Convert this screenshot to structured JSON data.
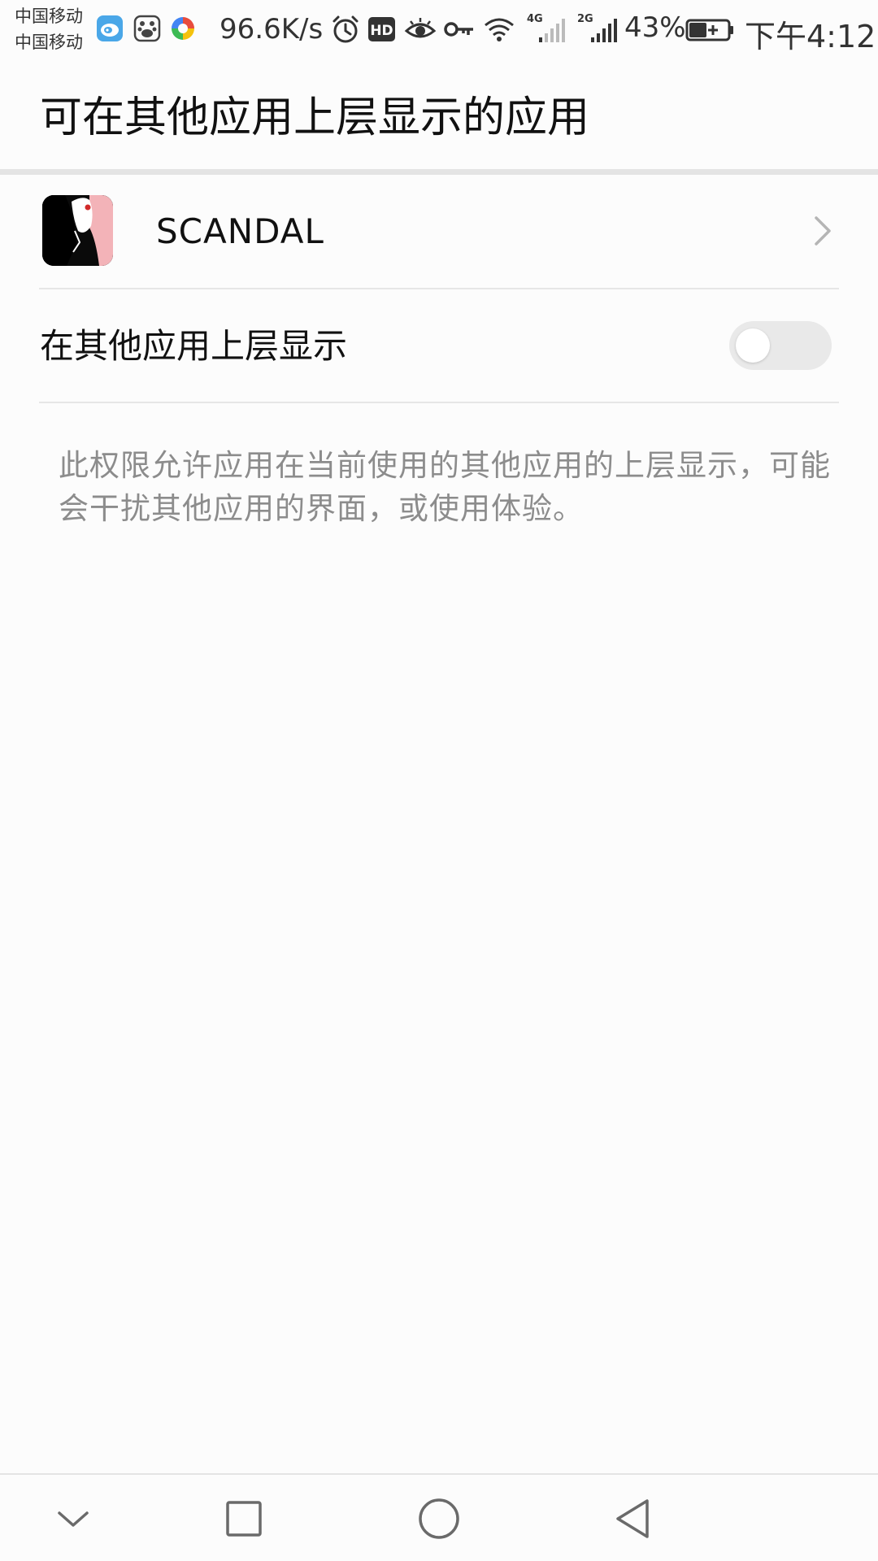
{
  "status_bar": {
    "carrier_1": "中国移动",
    "carrier_2": "中国移动",
    "network_speed": "96.6K/s",
    "signal_1_type": "4G",
    "signal_2_type": "2G",
    "battery_percent": "43%",
    "time": "下午4:12",
    "icons": [
      "weibo-icon",
      "baidu-icon",
      "color-app-icon",
      "alarm-icon",
      "hd-icon",
      "eye-icon",
      "key-icon",
      "wifi-icon",
      "signal-icon",
      "battery-icon"
    ]
  },
  "header": {
    "title": "可在其他应用上层显示的应用"
  },
  "app_row": {
    "app_name": "SCANDAL"
  },
  "permission": {
    "label": "在其他应用上层显示",
    "enabled": false
  },
  "description": "此权限允许应用在当前使用的其他应用的上层显示，可能会干扰其他应用的界面，或使用体验。",
  "nav_bar": {
    "buttons": [
      "hide-nav-icon",
      "recents-icon",
      "home-icon",
      "back-icon"
    ]
  },
  "colors": {
    "background": "#fcfcfc",
    "divider": "#e6e6e6",
    "secondary_text": "#8c8c8c",
    "switch_off_track": "#e9e9e9"
  }
}
